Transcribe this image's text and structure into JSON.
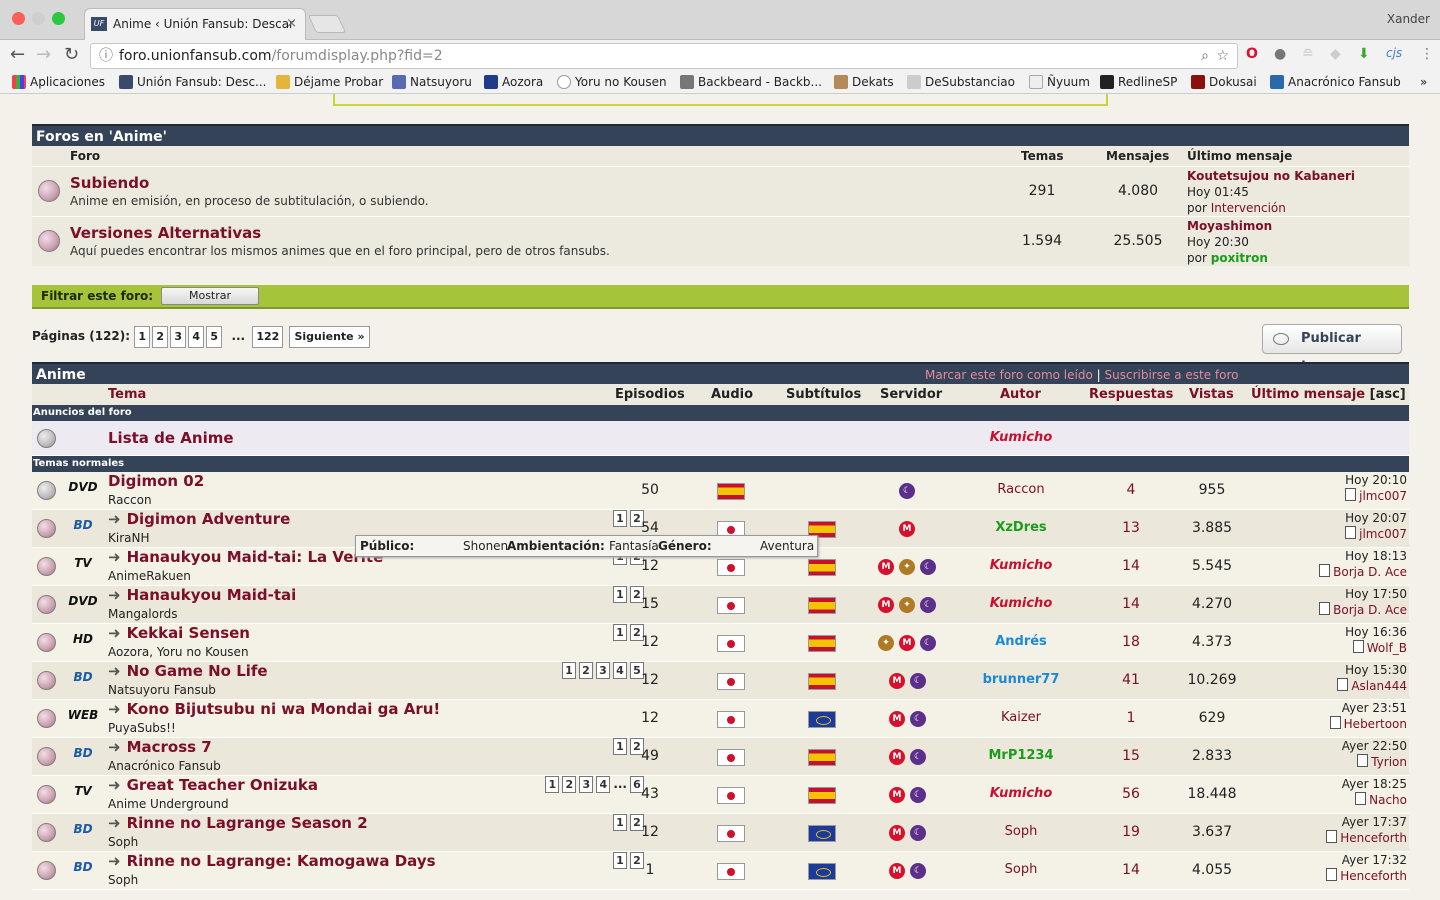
{
  "browser": {
    "tab_title": "Anime ‹ Unión Fansub: Descar",
    "user": "Xander",
    "url_host": "foro.unionfansub.com",
    "url_path": "/forumdisplay.php?fid=2",
    "ext_label": "cjs"
  },
  "bookmarks": [
    "Aplicaciones",
    "Unión Fansub: Desc...",
    "Déjame Probar",
    "Natsuyoru",
    "Aozora",
    "Yoru no Kousen",
    "Backbeard - Backb...",
    "Dekats",
    "DeSubstanciao",
    "Ñyuum",
    "RedlineSP",
    "Dokusai",
    "Anacrónico Fansub"
  ],
  "forums": {
    "title": "Foros en 'Anime'",
    "col_forum": "Foro",
    "col_topics": "Temas",
    "col_posts": "Mensajes",
    "col_last": "Último mensaje",
    "rows": [
      {
        "name": "Subiendo",
        "desc": "Anime en emisión, en proceso de subtitulación, o subiendo.",
        "topics": "291",
        "posts": "4.080",
        "last_title": "Koutetsujou no Kabaneri",
        "last_time": "Hoy 01:45",
        "last_by_prefix": "por",
        "last_by": "Intervención"
      },
      {
        "name": "Versiones Alternativas",
        "desc": "Aquí puedes encontrar los mismos animes que en el foro principal, pero de otros fansubs.",
        "topics": "1.594",
        "posts": "25.505",
        "last_title": "Moyashimon",
        "last_time": "Hoy 20:30",
        "last_by_prefix": "por",
        "last_by": "poxitron"
      }
    ]
  },
  "filter": {
    "label": "Filtrar este foro:",
    "button": "Mostrar"
  },
  "pagination": {
    "label": "Páginas (122):",
    "pages": [
      "1",
      "2",
      "3",
      "4",
      "5"
    ],
    "ellipsis": "...",
    "last": "122",
    "next": "Siguiente »"
  },
  "publish_label": "Publicar tema",
  "anime": {
    "title": "Anime",
    "mark_read": "Marcar este foro como leído",
    "sep": "|",
    "subscribe": "Suscribirse a este foro",
    "headers": {
      "topic": "Tema",
      "episodes": "Episodios",
      "audio": "Audio",
      "subs": "Subtítulos",
      "server": "Servidor",
      "author": "Autor",
      "replies": "Respuestas",
      "views": "Vistas",
      "last": "Último mensaje",
      "asc": "[asc]"
    },
    "section_announce": "Anuncios del foro",
    "announce_title": "Lista de Anime",
    "announce_author": "Kumicho",
    "section_normal": "Temas normales"
  },
  "topics": [
    {
      "media": "DVD",
      "title": "Digimon 02",
      "sub": "Raccon",
      "pages": [],
      "ep": "50",
      "audio": "es",
      "subs": "",
      "servers": [
        "moon"
      ],
      "author": "Raccon",
      "author_style": "plain",
      "replies": "4",
      "views": "955",
      "last_time": "Hoy 20:10",
      "last_by": "jlmc007"
    },
    {
      "media": "BD",
      "title": "Digimon Adventure",
      "sub": "KiraNH",
      "pages": [
        "1",
        "2"
      ],
      "ep": "54",
      "audio": "jp",
      "subs": "es",
      "servers": [
        "mega"
      ],
      "author": "XzDres",
      "author_style": "grn",
      "replies": "13",
      "views": "3.885",
      "last_time": "Hoy 20:07",
      "last_by": "jlmc007"
    },
    {
      "media": "TV",
      "title": "Hanaukyou Maid-tai: La Verite",
      "sub": "AnimeRakuen",
      "pages": [
        "1",
        "2"
      ],
      "ep": "12",
      "audio": "jp",
      "subs": "es",
      "servers": [
        "mega",
        "hen",
        "moon"
      ],
      "author": "Kumicho",
      "author_style": "kum",
      "replies": "14",
      "views": "5.545",
      "last_time": "Hoy 18:13",
      "last_by": "Borja D. Ace"
    },
    {
      "media": "DVD",
      "title": "Hanaukyou Maid-tai",
      "sub": "Mangalords",
      "pages": [
        "1",
        "2"
      ],
      "ep": "15",
      "audio": "jp",
      "subs": "es",
      "servers": [
        "mega",
        "hen",
        "moon"
      ],
      "author": "Kumicho",
      "author_style": "kum",
      "replies": "14",
      "views": "4.270",
      "last_time": "Hoy 17:50",
      "last_by": "Borja D. Ace"
    },
    {
      "media": "HD",
      "title": "Kekkai Sensen",
      "sub": "Aozora, Yoru no Kousen",
      "pages": [
        "1",
        "2"
      ],
      "ep": "12",
      "audio": "jp",
      "subs": "es",
      "servers": [
        "hen",
        "mega",
        "moon"
      ],
      "author": "Andrés",
      "author_style": "blu",
      "replies": "18",
      "views": "4.373",
      "last_time": "Hoy 16:36",
      "last_by": "Wolf_B"
    },
    {
      "media": "BD",
      "title": "No Game No Life",
      "sub": "Natsuyoru Fansub",
      "pages": [
        "1",
        "2",
        "3",
        "4",
        "5"
      ],
      "ep": "12",
      "audio": "jp",
      "subs": "es",
      "servers": [
        "mega",
        "moon"
      ],
      "author": "brunner77",
      "author_style": "blu",
      "replies": "41",
      "views": "10.269",
      "last_time": "Hoy 15:30",
      "last_by": "Aslan444"
    },
    {
      "media": "WEB",
      "title": "Kono Bijutsubu ni wa Mondai ga Aru!",
      "sub": "PuyaSubs!!",
      "pages": [],
      "ep": "12",
      "audio": "jp",
      "subs": "eu",
      "servers": [
        "mega",
        "moon"
      ],
      "author": "Kaizer",
      "author_style": "plain",
      "replies": "1",
      "views": "629",
      "last_time": "Ayer 23:51",
      "last_by": "Hebertoon"
    },
    {
      "media": "BD",
      "title": "Macross 7",
      "sub": "Anacrónico Fansub",
      "pages": [
        "1",
        "2"
      ],
      "ep": "49",
      "audio": "jp",
      "subs": "es",
      "servers": [
        "mega",
        "moon"
      ],
      "author": "MrP1234",
      "author_style": "grn",
      "replies": "15",
      "views": "2.833",
      "last_time": "Ayer 22:50",
      "last_by": "Tyrion"
    },
    {
      "media": "TV",
      "title": "Great Teacher Onizuka",
      "sub": "Anime Underground",
      "pages": [
        "1",
        "2",
        "3",
        "4",
        "...",
        "6"
      ],
      "ep": "43",
      "audio": "jp",
      "subs": "es",
      "servers": [
        "mega",
        "moon"
      ],
      "author": "Kumicho",
      "author_style": "kum",
      "replies": "56",
      "views": "18.448",
      "last_time": "Ayer 18:25",
      "last_by": "Nacho"
    },
    {
      "media": "BD",
      "title": "Rinne no Lagrange Season 2",
      "sub": "Soph",
      "pages": [
        "1",
        "2"
      ],
      "ep": "12",
      "audio": "jp",
      "subs": "eu",
      "servers": [
        "mega",
        "moon"
      ],
      "author": "Soph",
      "author_style": "plain",
      "replies": "19",
      "views": "3.637",
      "last_time": "Ayer 17:37",
      "last_by": "Henceforth"
    },
    {
      "media": "BD",
      "title": "Rinne no Lagrange: Kamogawa Days",
      "sub": "Soph",
      "pages": [
        "1",
        "2"
      ],
      "ep": "1",
      "audio": "jp",
      "subs": "eu",
      "servers": [
        "mega",
        "moon"
      ],
      "author": "Soph",
      "author_style": "plain",
      "replies": "14",
      "views": "4.055",
      "last_time": "Ayer 17:32",
      "last_by": "Henceforth"
    }
  ],
  "tooltip": {
    "l1": "Público:",
    "v1": "Shonen",
    "l2": "Ambientación:",
    "v2": "Fantasía",
    "l3": "Género:",
    "v3": "Aventura"
  }
}
